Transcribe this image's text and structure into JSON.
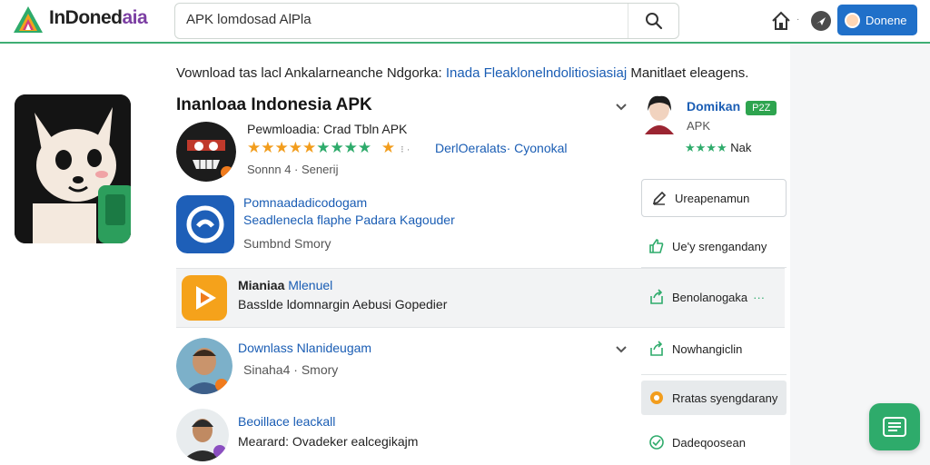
{
  "header": {
    "brand_part1": "InDoned",
    "brand_part2": "aia",
    "search_value": "APK lomdosad AlPla",
    "donate_label": "Donene",
    "separator": "·"
  },
  "tagline": {
    "prefix": "Vownload tas lacl Ankalarneanche Ndgorka:",
    "link": "Inada Fleaklonelndolitiosiasiaj",
    "suffix": "Manitlaet eleagens."
  },
  "main": {
    "title": "Inanloaa Indonesia APK",
    "rows": [
      {
        "title": "Pewmloadia: Crad Tbln APK",
        "rating_text": "DerlOeralats· Cyonokal",
        "meta": "Sonnn 4 · Senerij"
      },
      {
        "title": "Pomnaadadicodogam",
        "subtitle": "Seadlenecla flaphe Padara Kagouder",
        "meta": "Sumbnd   Smory"
      },
      {
        "title_dark": "Mianiaa",
        "title_link": "Mlenuel",
        "subtitle": "Basslde ldomnargin Aebusi Gopedier"
      },
      {
        "title": "Downlass Nlanideugam",
        "meta": "Sinaha4 · Smory"
      },
      {
        "title": "Beoillace leackall",
        "subtitle": "Mearard: Ovadeker ealcegikajm"
      }
    ]
  },
  "side": {
    "user_name": "Domikan",
    "user_badge": "P2Z",
    "user_sub": "APK",
    "user_rating": "Nak",
    "btn_primary": "Ureapenamun",
    "links": [
      "Ue'y srengandany",
      "Benolanogaka",
      "Nowhangiclin",
      "Rratas syengdarany",
      "Dadeqoosean"
    ],
    "more": "···"
  },
  "colors": {
    "accent_green": "#3fae74",
    "link_blue": "#1a5db4",
    "donate_blue": "#2070c9",
    "brand_purple": "#7c3fa3"
  },
  "icons": [
    "search-icon",
    "home-icon",
    "navigation-icon",
    "edit-icon",
    "thumb-up-icon",
    "share-icon",
    "chat-icon",
    "check-circle-icon",
    "list-icon"
  ]
}
